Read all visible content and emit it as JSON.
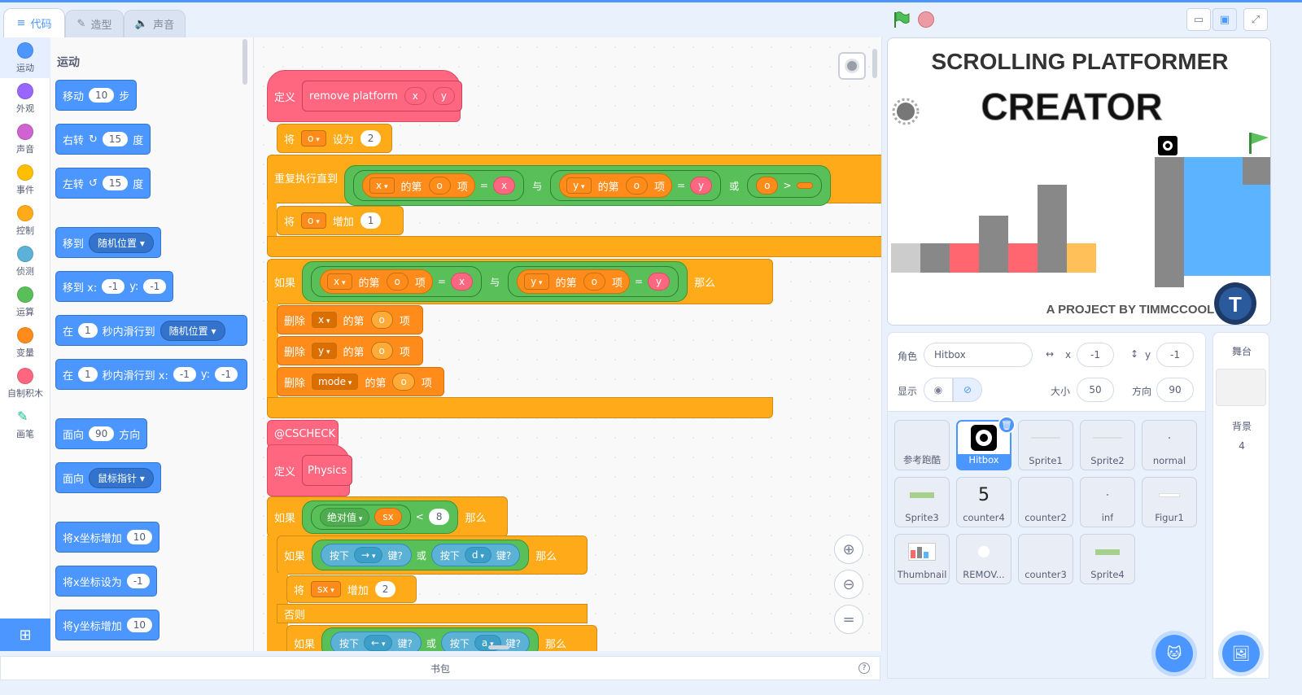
{
  "tabs": {
    "code": "代码",
    "costumes": "造型",
    "sounds": "声音"
  },
  "categories": [
    {
      "label": "运动",
      "color": "#4c97ff"
    },
    {
      "label": "外观",
      "color": "#9966ff"
    },
    {
      "label": "声音",
      "color": "#cf63cf"
    },
    {
      "label": "事件",
      "color": "#ffbf00"
    },
    {
      "label": "控制",
      "color": "#ffab19"
    },
    {
      "label": "侦测",
      "color": "#5cb1d6"
    },
    {
      "label": "运算",
      "color": "#59c059"
    },
    {
      "label": "变量",
      "color": "#ff8c1a"
    },
    {
      "label": "自制积木",
      "color": "#ff6680"
    },
    {
      "label": "画笔",
      "color": "#0fbd8c"
    }
  ],
  "palette": {
    "title": "运动",
    "move": {
      "a": "移动",
      "n": "10",
      "b": "步"
    },
    "turn_right": {
      "a": "右转",
      "n": "15",
      "b": "度"
    },
    "turn_left": {
      "a": "左转",
      "n": "15",
      "b": "度"
    },
    "goto": {
      "a": "移到",
      "dd": "随机位置"
    },
    "goto_xy": {
      "a": "移到 x:",
      "x": "-1",
      "yl": "y:",
      "y": "-1"
    },
    "glide": {
      "a": "在",
      "n": "1",
      "b": "秒内滑行到",
      "dd": "随机位置"
    },
    "glide_xy": {
      "a": "在",
      "n": "1",
      "b": "秒内滑行到 x:",
      "x": "-1",
      "yl": "y:",
      "y": "-1"
    },
    "point_dir": {
      "a": "面向",
      "n": "90",
      "b": "方向"
    },
    "point_towards": {
      "a": "面向",
      "dd": "鼠标指针"
    },
    "change_x": {
      "a": "将x坐标增加",
      "n": "10"
    },
    "set_x": {
      "a": "将x坐标设为",
      "n": "-1"
    },
    "change_y": {
      "a": "将y坐标增加",
      "n": "10"
    }
  },
  "script": {
    "define1": {
      "kw": "定义",
      "name": "remove platform",
      "p1": "x",
      "p2": "y"
    },
    "set_o": {
      "a": "将",
      "var": "o",
      "b": "设为",
      "v": "2"
    },
    "repeat_until": {
      "a": "重复执行直到",
      "l1": "x",
      "item": "的第",
      "o": "o",
      "xiang": "项",
      "eq": "=",
      "x": "x",
      "and": "与",
      "l2": "y",
      "y": "y",
      "or": "或",
      "o2": "o",
      "gt": ">"
    },
    "change_o": {
      "a": "将",
      "var": "o",
      "b": "增加",
      "v": "1"
    },
    "if1": {
      "a": "如果",
      "l1": "x",
      "item": "的第",
      "o": "o",
      "xiang": "项",
      "eq": "=",
      "x": "x",
      "and": "与",
      "l2": "y",
      "y": "y",
      "then": "那么"
    },
    "del_x": {
      "a": "删除",
      "l": "x",
      "b": "的第",
      "o": "o",
      "c": "项"
    },
    "del_y": {
      "a": "删除",
      "l": "y",
      "b": "的第",
      "o": "o",
      "c": "项"
    },
    "del_mode": {
      "a": "删除",
      "l": "mode",
      "b": "的第",
      "o": "o",
      "c": "项"
    },
    "comment": "@CSCHECK",
    "define2": {
      "kw": "定义",
      "name": "Physics"
    },
    "if2": {
      "a": "如果",
      "fn": "绝对值",
      "v": "sx",
      "lt": "<",
      "n": "8",
      "then": "那么"
    },
    "if3": {
      "a": "如果",
      "k1": "按下",
      "key1": "→",
      "k1b": "键?",
      "or": "或",
      "k2": "按下",
      "key2": "d",
      "k2b": "键?",
      "then": "那么"
    },
    "change_sx": {
      "a": "将",
      "var": "sx",
      "b": "增加",
      "v": "2"
    },
    "else": "否则",
    "if4": {
      "a": "如果",
      "k1": "按下",
      "key1": "←",
      "k1b": "键?",
      "or": "或",
      "k2": "按下",
      "key2": "a",
      "k2b": "键?",
      "then": "那么"
    }
  },
  "backpack": "书包",
  "stage": {
    "title1": "SCROLLING PLATFORMER",
    "title2": "CREATOR",
    "credit": "A PROJECT BY TIMMCCOOL",
    "logo": "T"
  },
  "sprite_info": {
    "sprite_label": "角色",
    "sprite_name": "Hitbox",
    "x_label": "x",
    "x": "-1",
    "y_label": "y",
    "y": "-1",
    "show_label": "显示",
    "size_label": "大小",
    "size": "50",
    "dir_label": "方向",
    "dir": "90"
  },
  "sprites": [
    "参考跑酷",
    "Hitbox",
    "Sprite1",
    "Sprite2",
    "normal",
    "Sprite3",
    "counter4",
    "counter2",
    "inf",
    "Figur1",
    "Thumbnail",
    "REMOV...",
    "counter3",
    "Sprite4"
  ],
  "counter4_value": "5",
  "stage_pane": {
    "title": "舞台",
    "backdrops_label": "背景",
    "backdrops_count": "4"
  },
  "colors": {
    "motion": "#4c97ff",
    "control": "#ffab19",
    "custom": "#ff6680",
    "variables": "#ff8c1a",
    "operators": "#59c059",
    "sensing": "#5cb1d6"
  }
}
